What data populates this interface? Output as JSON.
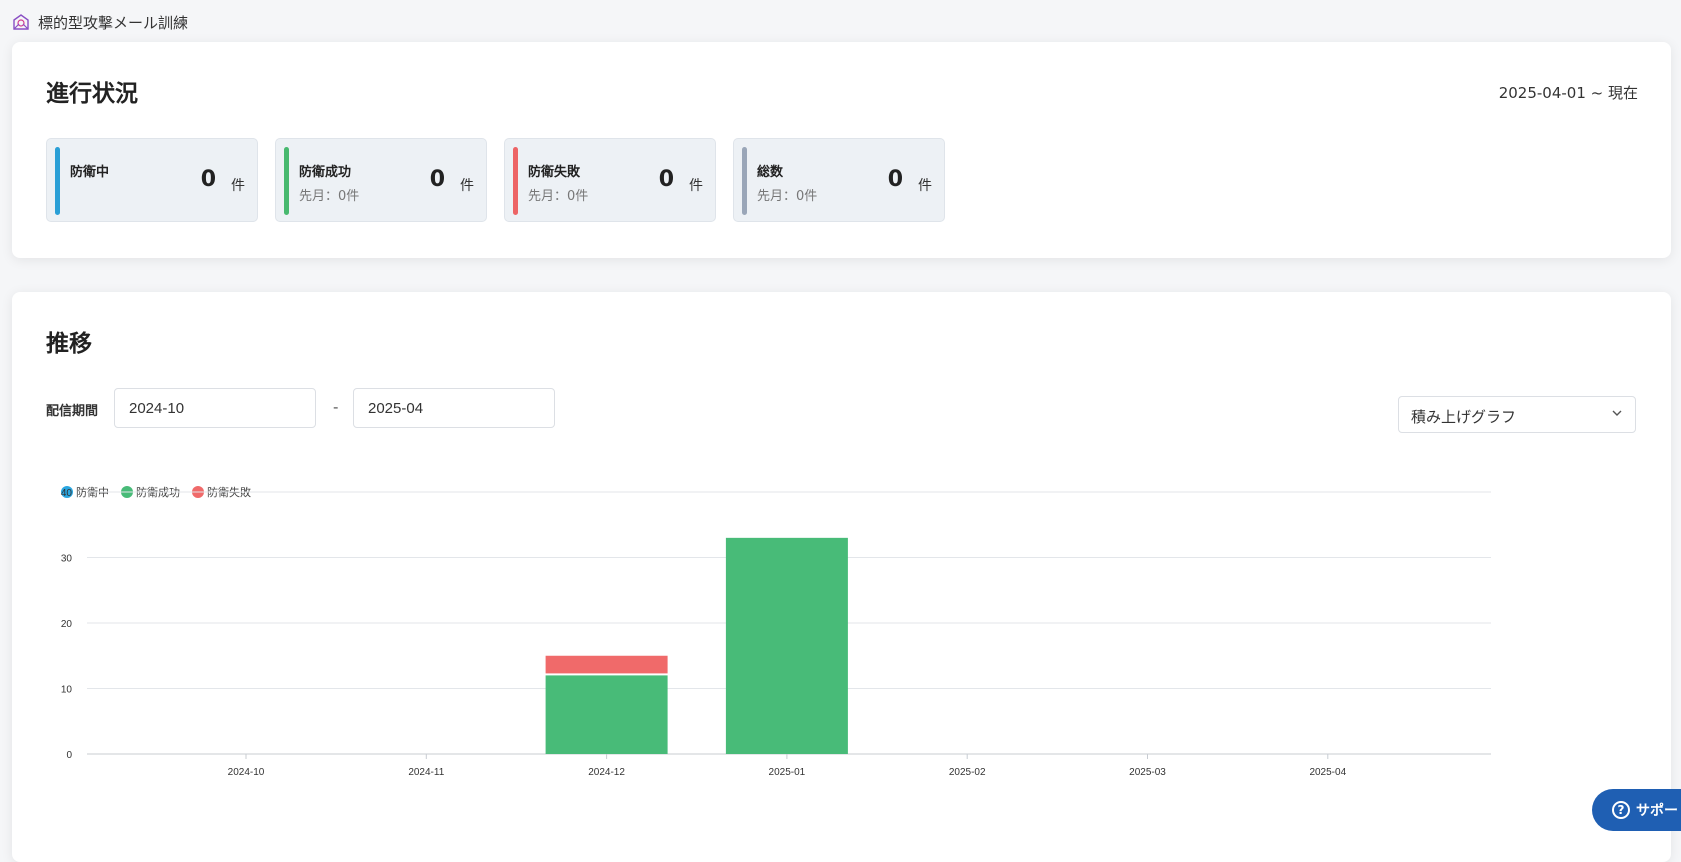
{
  "app": {
    "title": "標的型攻撃メール訓練",
    "icon": "mail-shield-icon"
  },
  "progress": {
    "title": "進行状況",
    "date_range": "2025-04-01 ~ 現在",
    "stats": [
      {
        "label": "防衛中",
        "value": "0",
        "unit": "件",
        "sub": "",
        "color": "#2a9fd6"
      },
      {
        "label": "防衛成功",
        "value": "0",
        "unit": "件",
        "sub": "先月：0件",
        "color": "#48b96f"
      },
      {
        "label": "防衛失敗",
        "value": "0",
        "unit": "件",
        "sub": "先月：0件",
        "color": "#ed6465"
      },
      {
        "label": "総数",
        "value": "0",
        "unit": "件",
        "sub": "先月：0件",
        "color": "#9aa6b8"
      }
    ]
  },
  "trend": {
    "title": "推移",
    "period_label": "配信期間",
    "date_from": "2024-10",
    "date_to": "2025-04",
    "dash": "-",
    "graph_type": "積み上げグラフ"
  },
  "support": {
    "label": "サポート"
  },
  "chart_data": {
    "type": "bar",
    "stacked": true,
    "categories": [
      "2024-10",
      "2024-11",
      "2024-12",
      "2025-01",
      "2025-02",
      "2025-03",
      "2025-04"
    ],
    "series": [
      {
        "name": "防衛中",
        "color": "#2aa6e0",
        "values": [
          0,
          0,
          0,
          0,
          0,
          0,
          0
        ]
      },
      {
        "name": "防衛成功",
        "color": "#48bb78",
        "values": [
          0,
          0,
          12,
          33,
          0,
          0,
          0
        ]
      },
      {
        "name": "防衛失敗",
        "color": "#f06a6a",
        "values": [
          0,
          0,
          3,
          0,
          0,
          0,
          0
        ]
      }
    ],
    "ylim": [
      0,
      40
    ],
    "yticks": [
      0,
      10,
      20,
      30,
      40
    ],
    "grid": true,
    "legend": "top-left"
  }
}
